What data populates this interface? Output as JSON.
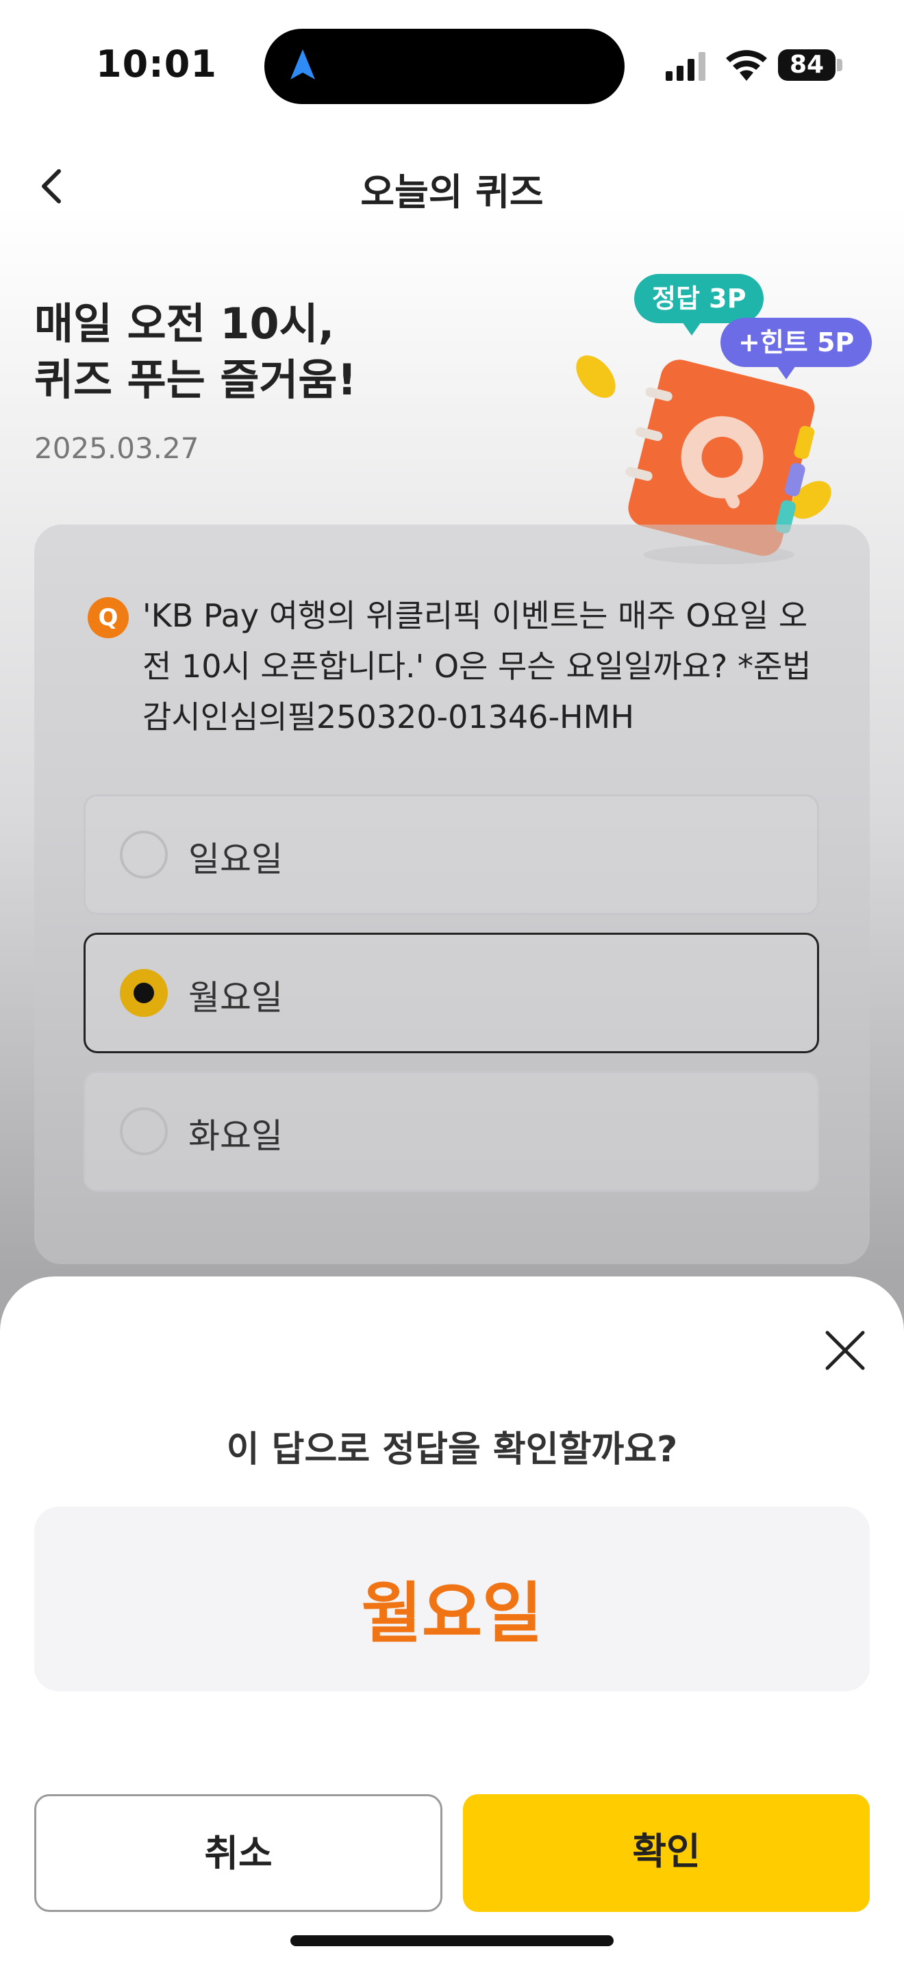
{
  "status_bar": {
    "time": "10:01",
    "battery": "84"
  },
  "header": {
    "title": "오늘의 퀴즈"
  },
  "hero": {
    "title_line1": "매일 오전 10시,",
    "title_line2": "퀴즈 푸는 즐거움!",
    "date": "2025.03.27"
  },
  "illustration": {
    "badge_correct": "정답 3P",
    "badge_hint": "+힌트 5P"
  },
  "question": {
    "badge": "Q",
    "text": "'KB Pay 여행의 위클리픽 이벤트는 매주 O요일 오전 10시 오픈합니다.' O은 무슨 요일일까요? *준법감시인심의필250320-01346-HMH",
    "options": [
      {
        "label": "일요일",
        "selected": false
      },
      {
        "label": "월요일",
        "selected": true
      },
      {
        "label": "화요일",
        "selected": false
      }
    ]
  },
  "sheet": {
    "title": "이 답으로 정답을 확인할까요?",
    "answer": "월요일",
    "cancel_label": "취소",
    "confirm_label": "확인"
  },
  "colors": {
    "accent_orange": "#f07314",
    "confirm_yellow": "#ffcc00",
    "radio_selected": "#e1ad0e",
    "badge_teal": "#1fb5ab",
    "badge_purple": "#6c6ce6"
  }
}
